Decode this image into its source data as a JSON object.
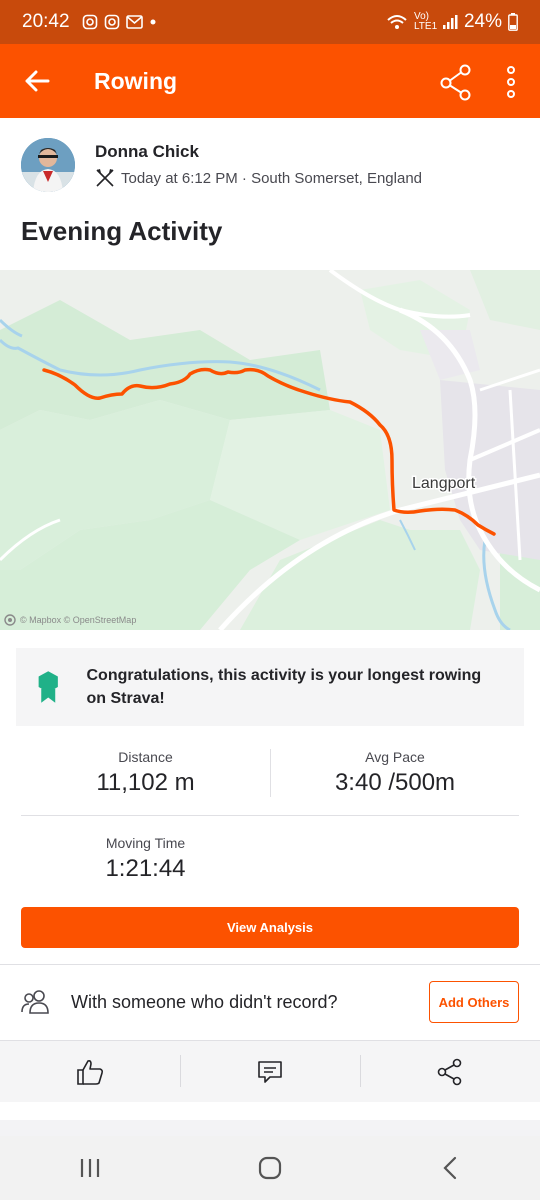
{
  "status_bar": {
    "time": "20:42",
    "network": "Vo) LTE1",
    "battery": "24%"
  },
  "header": {
    "title": "Rowing",
    "icons": [
      "back-arrow-icon",
      "share-icon",
      "more-vertical-icon"
    ]
  },
  "athlete": {
    "name": "Donna Chick",
    "meta": "Today at 6:12 PM · South Somerset, England",
    "sport_icon": "rowing-oars-icon"
  },
  "activity": {
    "title": "Evening Activity"
  },
  "map": {
    "place_label": "Langport",
    "attribution": "© Mapbox © OpenStreetMap",
    "route_color": "#fc5200"
  },
  "achievement": {
    "text": "Congratulations, this activity is your longest rowing on Strava!",
    "icon": "achievement-badge-icon"
  },
  "stats": {
    "distance_label": "Distance",
    "distance_value": "11,102 m",
    "pace_label": "Avg Pace",
    "pace_value": "3:40 /500m",
    "moving_time_label": "Moving Time",
    "moving_time_value": "1:21:44"
  },
  "buttons": {
    "view_analysis": "View Analysis",
    "add_others": "Add Others"
  },
  "with_others": {
    "text": "With someone who didn't record?"
  },
  "actions": [
    "kudos-thumbs-up-icon",
    "comment-icon",
    "share-icon"
  ],
  "nav": [
    "recent-apps-icon",
    "home-icon",
    "back-icon"
  ],
  "colors": {
    "brand": "#fc5200",
    "status_bar": "#c84a0c",
    "badge": "#20b188"
  }
}
